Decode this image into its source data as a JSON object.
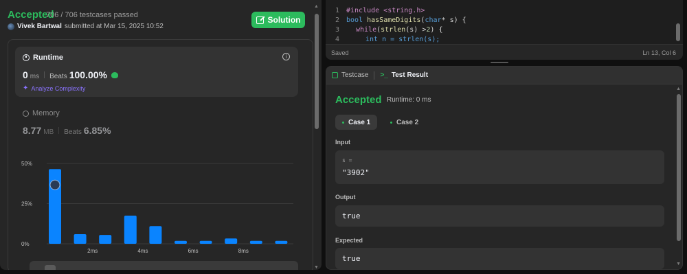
{
  "submission": {
    "status": "Accepted",
    "passed": "706 / 706 testcases passed",
    "user": "Vivek Bartwal",
    "submitted_text": "submitted at Mar 15, 2025 10:52",
    "solution_label": "Solution"
  },
  "runtime": {
    "label": "Runtime",
    "value": "0",
    "unit": "ms",
    "beats_label": "Beats",
    "beats_value": "100.00%",
    "analyze_label": "Analyze Complexity"
  },
  "memory": {
    "label": "Memory",
    "value": "8.77",
    "unit": "MB",
    "beats_label": "Beats",
    "beats_value": "6.85%"
  },
  "chart_data": {
    "type": "bar",
    "y_ticks": [
      "50%",
      "25%",
      "0%"
    ],
    "x_ticks": [
      "2ms",
      "4ms",
      "6ms",
      "8ms"
    ],
    "values": [
      46.5,
      6,
      5.5,
      17.5,
      11,
      1.8,
      1.8,
      3.3,
      1.8,
      1.8
    ],
    "ylim": [
      0,
      50
    ],
    "bar_color": "#0a84ff",
    "highlight_index": 0
  },
  "editor": {
    "line_numbers": [
      "1",
      "2",
      "3",
      "4"
    ],
    "line1": "#include <string.h>",
    "line2_kw": "bool",
    "line2_fn": "hasSameDigits",
    "line2_rest_a": "(",
    "line2_type": "char",
    "line2_rest_b": "* s) {",
    "line3_kw": "while",
    "line3_rest_a": " (",
    "line3_fn": "strlen",
    "line3_rest_b": "(s) > ",
    "line3_num": "2",
    "line3_rest_c": ") {",
    "line4": "int n = strlen(s);",
    "saved": "Saved",
    "position": "Ln 13, Col 6"
  },
  "test_panel": {
    "tab_testcase": "Testcase",
    "tab_result": "Test Result",
    "status": "Accepted",
    "runtime": "Runtime: 0 ms",
    "case1": "Case 1",
    "case2": "Case 2",
    "input_label": "Input",
    "input_var": "s =",
    "input_value": "\"3902\"",
    "output_label": "Output",
    "output_value": "true",
    "expected_label": "Expected",
    "expected_value": "true"
  },
  "colors": {
    "accent_green": "#2cbb5d",
    "bar_blue": "#0a84ff",
    "analyze_purple": "#8a73ff"
  }
}
